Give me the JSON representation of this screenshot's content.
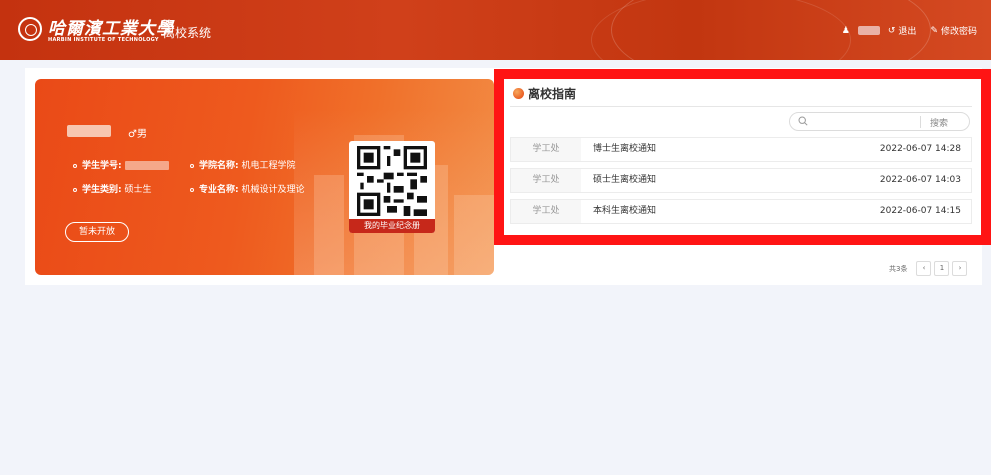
{
  "header": {
    "logo_cn": "哈爾濱工業大學",
    "logo_en": "HARBIN INSTITUTE OF TECHNOLOGY",
    "system_name": "离校系统",
    "logout_label": "退出",
    "change_password_label": "修改密码"
  },
  "student": {
    "gender": "♂男",
    "id_label": "学生学号:",
    "type_label": "学生类别:",
    "type_value": "硕士生",
    "college_label": "学院名称:",
    "college_value": "机电工程学院",
    "major_label": "专业名称:",
    "major_value": "机械设计及理论",
    "upgrade_button": "暂未开放",
    "qr_label": "我的毕业纪念册"
  },
  "guide": {
    "title": "离校指南",
    "search_placeholder": "",
    "search_button": "搜索",
    "items": [
      {
        "dept": "学工处",
        "title": "博士生离校通知",
        "time": "2022-06-07 14:28"
      },
      {
        "dept": "学工处",
        "title": "硕士生离校通知",
        "time": "2022-06-07 14:03"
      },
      {
        "dept": "学工处",
        "title": "本科生离校通知",
        "time": "2022-06-07 14:15"
      }
    ]
  },
  "pagination": {
    "total": "共3条",
    "prev": "‹",
    "page": "1",
    "next": "›"
  },
  "colors": {
    "header_red": "#c4320f",
    "card_orange": "#ee5a1e",
    "highlight_red": "#ff1414"
  }
}
